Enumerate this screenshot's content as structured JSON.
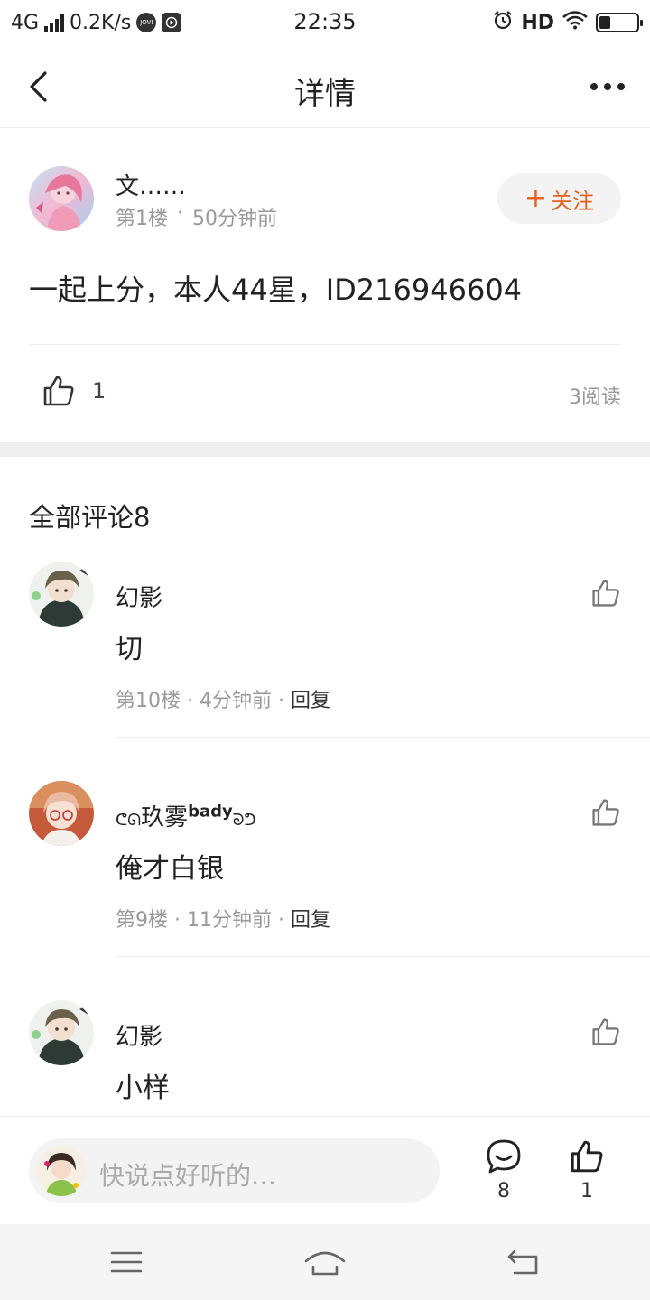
{
  "status_bar": {
    "network": "4G",
    "speed": "0.2K/s",
    "app_badge": "JOVI",
    "time": "22:35",
    "hd": "HD",
    "battery_level": 0.3
  },
  "nav": {
    "title": "详情"
  },
  "post": {
    "author": "文……",
    "floor": "第1楼",
    "time": "50分钟前",
    "follow_label": "关注",
    "content": "一起上分，本人44星，ID216946604",
    "like_count": "1",
    "read_count": "3阅读"
  },
  "comments": {
    "title": "全部评论8",
    "items": [
      {
        "name": "幻影",
        "text": "切",
        "floor": "第10楼",
        "time": "4分钟前",
        "reply": "回复"
      },
      {
        "name": "玖雾",
        "name_sup": "bady",
        "text": " 俺才白银",
        "floor": "第9楼",
        "time": "11分钟前",
        "reply": "回复"
      },
      {
        "name": "幻影",
        "text": "小样"
      }
    ]
  },
  "bottom_bar": {
    "placeholder": "快说点好听的…",
    "comment_count": "8",
    "like_count": "1"
  },
  "colors": {
    "accent": "#e8601f",
    "muted_text": "#999999",
    "divider": "#eeeeee"
  },
  "icons": {
    "back": "back-arrow-icon",
    "more": "more-dots-icon",
    "like": "thumbs-up-icon",
    "comment": "comment-bubble-icon",
    "menu": "menu-icon",
    "home": "home-icon",
    "return": "return-icon"
  }
}
